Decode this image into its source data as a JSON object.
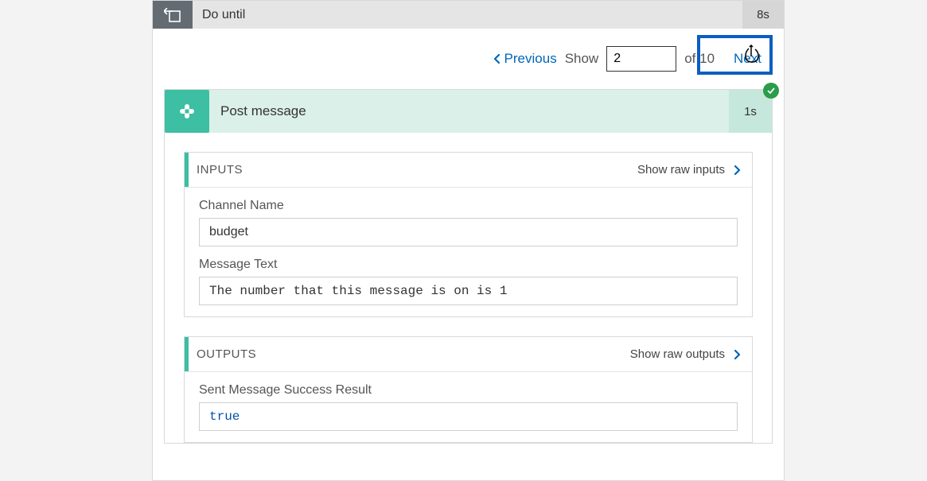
{
  "loop": {
    "title": "Do until",
    "time": "8s"
  },
  "pager": {
    "prev": "Previous",
    "show": "Show",
    "value": "2",
    "of_total": "of 10",
    "next": "Next"
  },
  "step": {
    "title": "Post message",
    "time": "1s"
  },
  "inputs": {
    "section_title": "INPUTS",
    "show_raw": "Show raw inputs",
    "fields": {
      "channel_name": {
        "label": "Channel Name",
        "value": "budget"
      },
      "message_text": {
        "label": "Message Text",
        "value": "The number that this message is on is 1"
      }
    }
  },
  "outputs": {
    "section_title": "OUTPUTS",
    "show_raw": "Show raw outputs",
    "fields": {
      "sent_success": {
        "label": "Sent Message Success Result",
        "value": "true"
      }
    }
  }
}
